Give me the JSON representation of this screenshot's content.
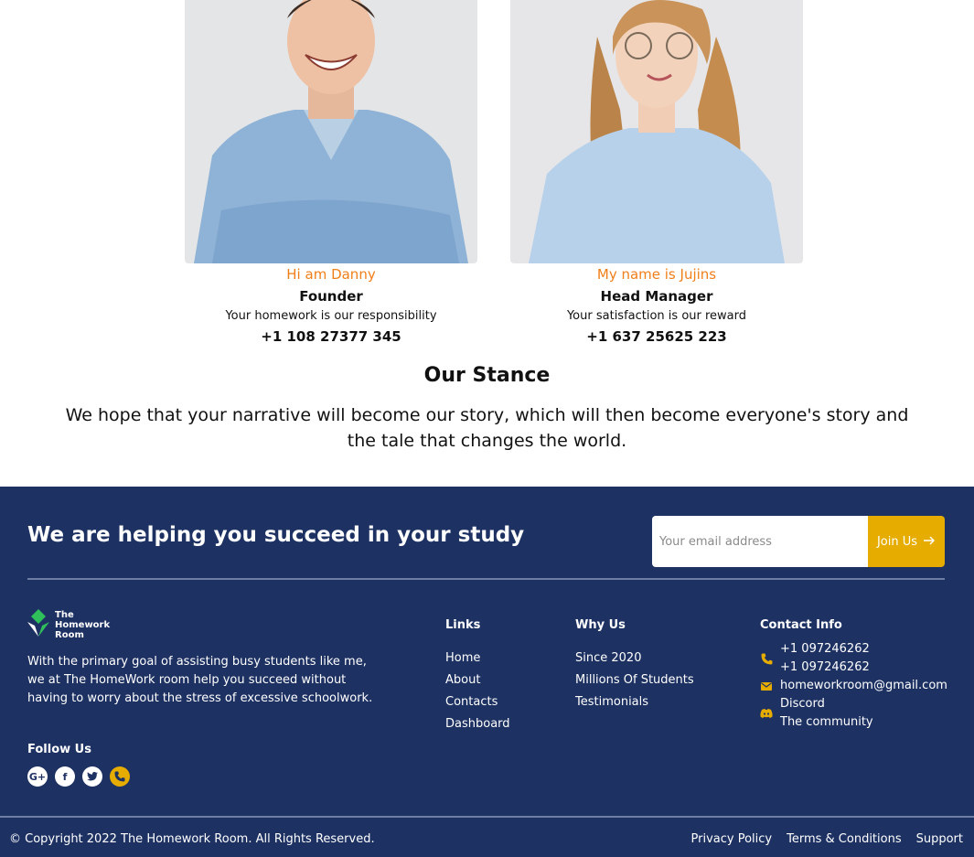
{
  "team": [
    {
      "greeting": "Hi am Danny",
      "role": "Founder",
      "motto": "Your homework is our responsibility",
      "phone": "+1 108 27377 345"
    },
    {
      "greeting": "My name is Jujins",
      "role": "Head Manager",
      "motto": "Your satisfaction is our reward",
      "phone": "+1 637 25625 223"
    }
  ],
  "stance": {
    "title": "Our Stance",
    "text": "We hope that your narrative will become our story, which will then become everyone's story and the tale that changes the world."
  },
  "footer": {
    "headline": "We are helping you succeed in your study",
    "email_placeholder": "Your email address",
    "join_label": "Join Us",
    "logo_line1": "The",
    "logo_line2": "Homework",
    "logo_line3": "Room",
    "about": "With the primary goal of assisting busy students like me, we at The HomeWork room help you succeed without having to worry about the stress of excessive schoolwork.",
    "follow_title": "Follow Us",
    "links": {
      "title": "Links",
      "items": [
        "Home",
        "About",
        "Contacts",
        "Dashboard"
      ]
    },
    "why": {
      "title": "Why Us",
      "items": [
        "Since 2020",
        "Millions Of Students",
        "Testimonials"
      ]
    },
    "contact": {
      "title": "Contact Info",
      "phone1": "+1 097246262",
      "phone2": "+1 097246262",
      "email": "homeworkroom@gmail.com",
      "discord1": "Discord",
      "discord2": "The community"
    },
    "copyright": "© Copyright 2022 The Homework Room. All Rights Reserved.",
    "legal": [
      "Privacy Policy",
      "Terms & Conditions",
      "Support"
    ]
  },
  "colors": {
    "accent_orange": "#f07f1a",
    "footer_bg": "#1d3163",
    "button_yellow": "#e6ad00"
  }
}
